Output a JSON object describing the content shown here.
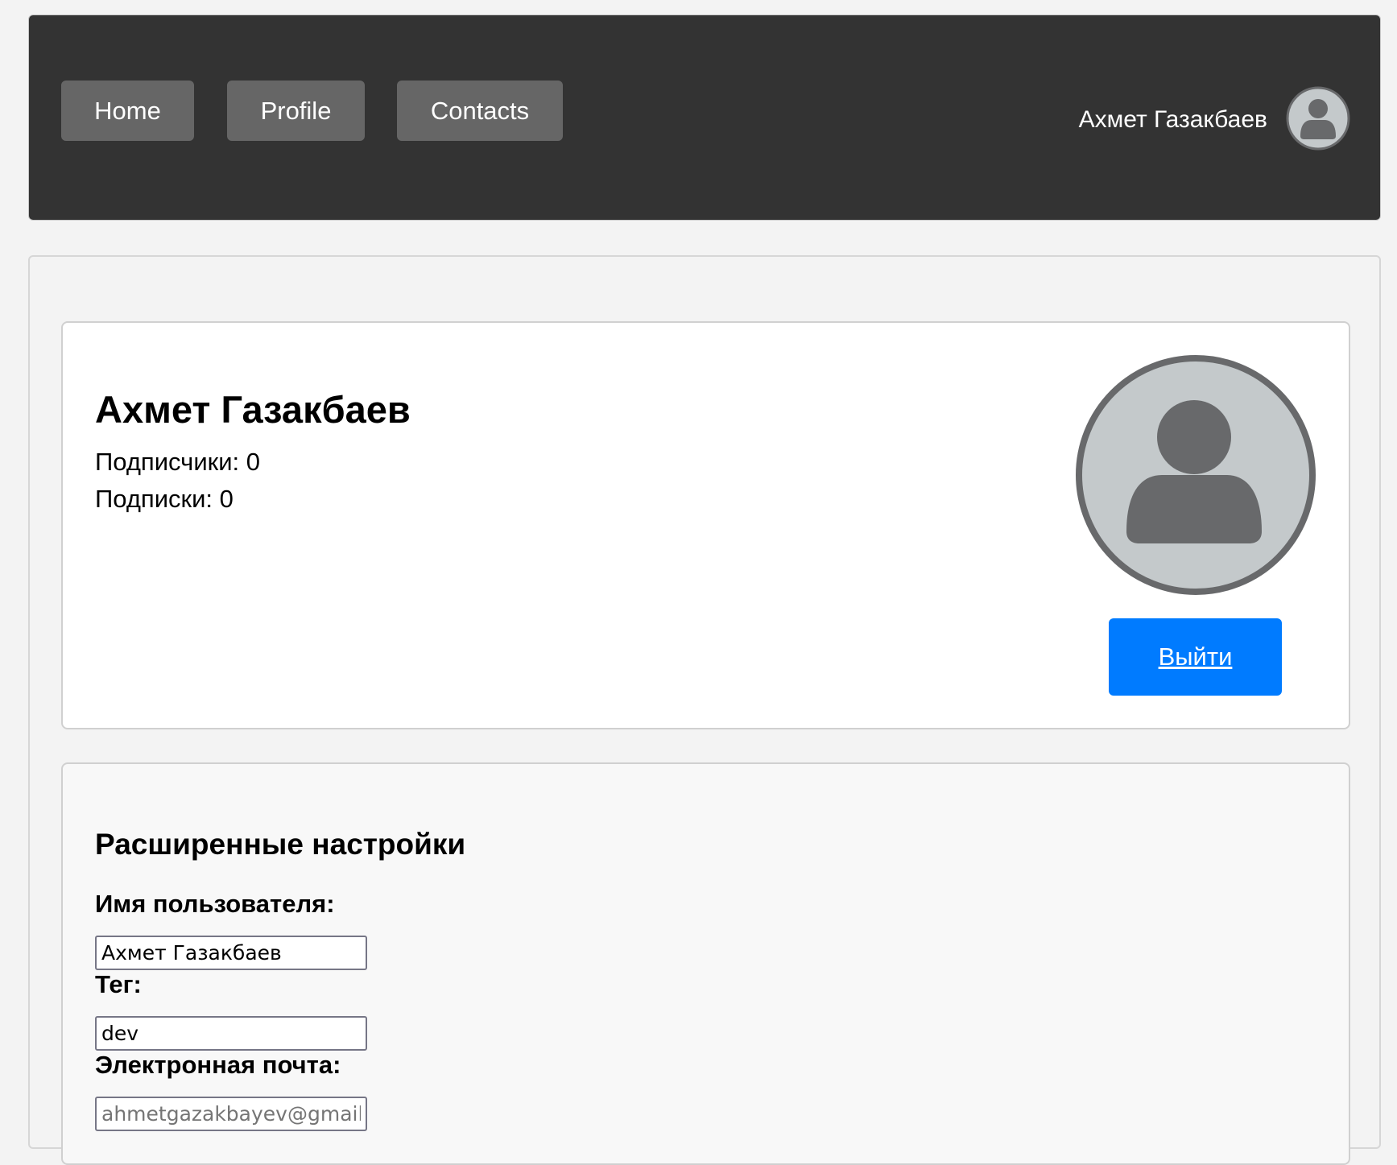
{
  "header": {
    "nav": {
      "home_label": "Home",
      "profile_label": "Profile",
      "contacts_label": "Contacts"
    },
    "user_name": "Ахмет Газакбаев",
    "avatar_icon": "user-avatar-icon"
  },
  "profile": {
    "name": "Ахмет Газакбаев",
    "followers": "Подписчики: 0",
    "following": "Подписки: 0",
    "avatar_icon": "user-avatar-icon",
    "logout_label": "Выйти"
  },
  "settings": {
    "title": "Расширенные настройки",
    "username_label": "Имя пользователя:",
    "username_value": "Ахмет Газакбаев",
    "tag_label": "Тег:",
    "tag_value": "dev",
    "email_label": "Электронная почта:",
    "email_placeholder": "ahmetgazakbayev@gmail.com"
  },
  "colors": {
    "header_bg": "#333333",
    "nav_button_bg": "#666666",
    "accent": "#007bff",
    "avatar_fill": "#c4c9cb",
    "avatar_figure": "#68696b"
  }
}
